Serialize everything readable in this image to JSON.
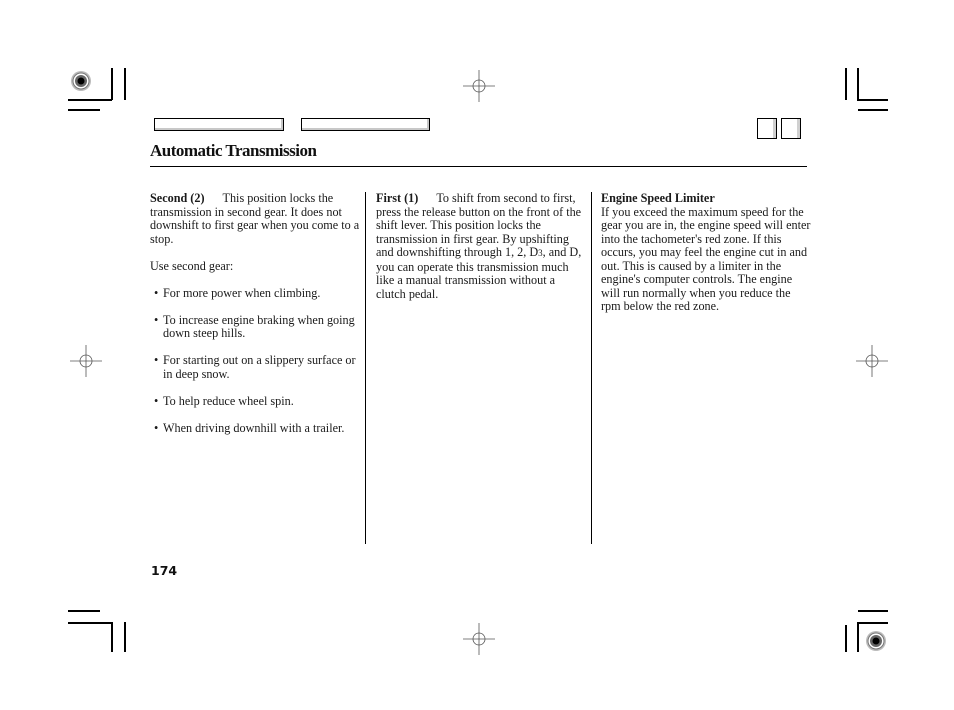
{
  "header": {
    "title": "Automatic Transmission",
    "nav_buttons": [
      "",
      ""
    ],
    "corner_buttons": [
      "",
      ""
    ]
  },
  "columns": [
    {
      "heading": "Second (2)",
      "intro": "This position locks the transmission in second gear. It does not downshift to first gear when you come to a stop.",
      "lead": "Use second gear:",
      "bullets": [
        "For more power when climbing.",
        "To increase engine braking when going down steep hills.",
        "For starting out on a slippery surface or in deep snow.",
        "To help reduce wheel spin.",
        "When driving downhill with a trailer."
      ]
    },
    {
      "heading": "First (1)",
      "text_before_sub": "To shift from second to first, press the release button on the front of the shift lever. This position locks the transmission in first gear. By upshifting and downshifting through 1, 2, D",
      "subscript": "3",
      "text_after_sub": ", and D, you can operate this transmission much like a manual transmission without a clutch pedal."
    },
    {
      "heading": "Engine Speed Limiter",
      "text": "If you exceed the maximum speed for the gear you are in, the engine speed will enter into the tachometer's red zone. If this occurs, you may feel the engine cut in and out. This is caused by a limiter in the engine's computer controls. The engine will run normally when you reduce the rpm below the red zone."
    }
  ],
  "footer": {
    "page_number": "174"
  },
  "icons": {
    "registration_mark": "crosshair-circle-icon",
    "color_target": "print-target-icon",
    "crop_mark": "crop-mark-icon"
  }
}
